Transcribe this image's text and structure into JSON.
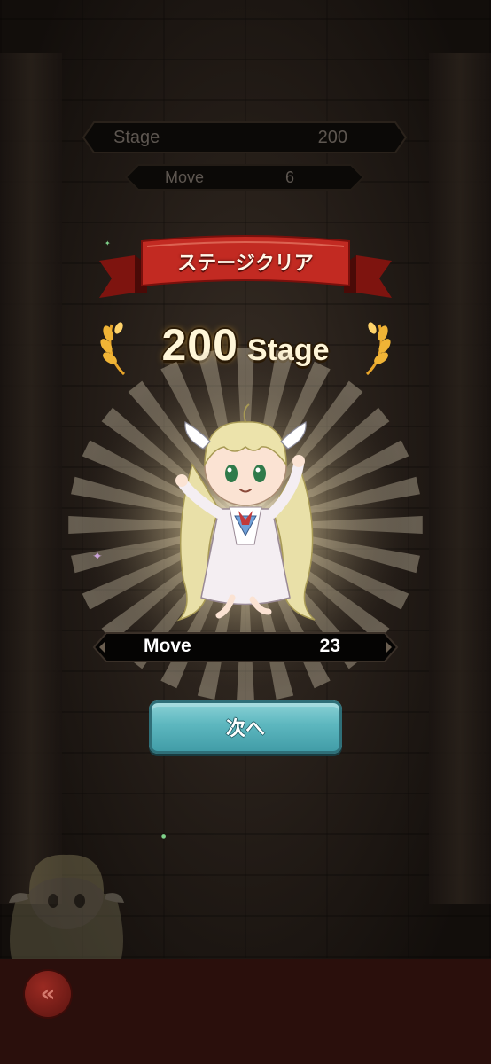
{
  "header": {
    "stage_label": "Stage",
    "stage_value": "200",
    "move_label": "Move",
    "move_value": "6"
  },
  "result": {
    "banner": "ステージクリア",
    "stage_number": "200",
    "stage_word": "Stage",
    "move_label": "Move",
    "move_value": "23",
    "next_button": "次へ"
  },
  "footer": {
    "back_icon": "double-chevron-left-icon"
  },
  "colors": {
    "ribbon_red": "#c22a22",
    "button_teal": "#5db7bf",
    "gold": "#f0b436",
    "bottom_bar": "#2a0f0c"
  }
}
